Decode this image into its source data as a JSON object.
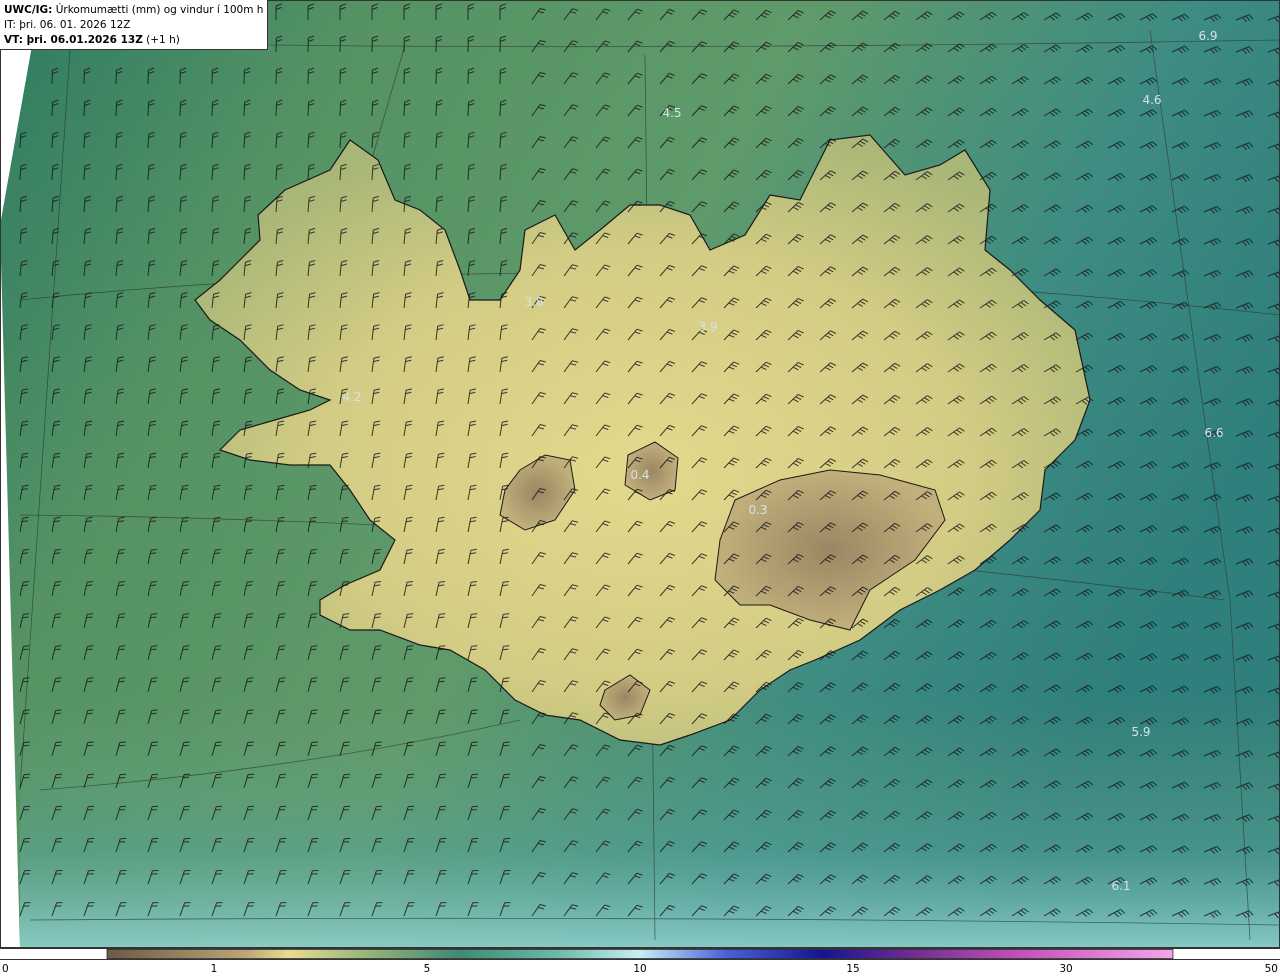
{
  "header": {
    "title_prefix": "UWC/IG:",
    "title_text": "Úrkomumætti (mm) og vindur í 100m hæð",
    "init_time": "IT: þri. 06. 01. 2026 12Z",
    "valid_label": "VT: þri. 06.01.2026 13Z",
    "lead_text": "(+1 h)"
  },
  "value_labels": [
    {
      "text": "6.9",
      "color": "#cfe0e6"
    },
    {
      "text": "4.6",
      "color": "#cfe0e6"
    },
    {
      "text": "4.5",
      "color": "#cfe0e6"
    },
    {
      "text": "3.8",
      "color": "#cfe0e6"
    },
    {
      "text": "3.9",
      "color": "#cfe0e6"
    },
    {
      "text": "4.2",
      "color": "#cfe0e6"
    },
    {
      "text": "6.6",
      "color": "#cfe0e6"
    },
    {
      "text": "0.4",
      "color": "#cfe0e6"
    },
    {
      "text": "0.3",
      "color": "#cfe0e6"
    },
    {
      "text": "5.9",
      "color": "#cfe0e6"
    },
    {
      "text": "6.1",
      "color": "#cfe0e6"
    }
  ],
  "colorbar": {
    "ticks": [
      "0",
      "1",
      "5",
      "10",
      "15",
      "30",
      "50"
    ],
    "stops": [
      "#6b5a44",
      "#b9a576",
      "#e8dc8e",
      "#8fb27a",
      "#3f8a72",
      "#69b7a9",
      "#bfe9f0",
      "#1a2aa8",
      "#3a1f7a",
      "#c34ab8",
      "#ef9ae6"
    ]
  },
  "map_colors": {
    "sea_west": "#2f8268",
    "sea_east": "#3d8d86",
    "land_low": "#c9c77f",
    "land_high": "#e6dc8c",
    "glacier": "#b39f72",
    "coast": "#1a1a1a"
  }
}
